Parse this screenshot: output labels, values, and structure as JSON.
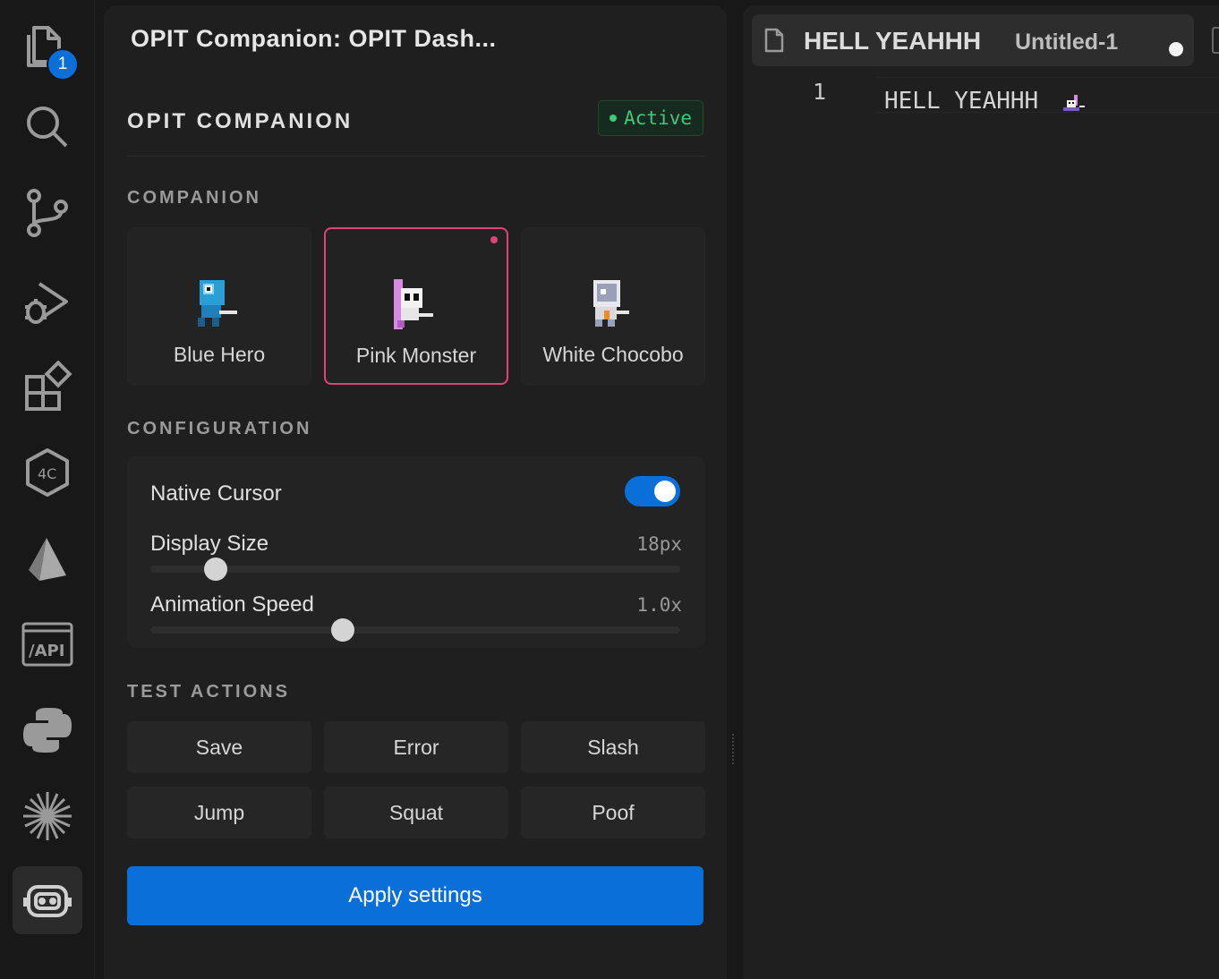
{
  "activity_bar": {
    "items": [
      {
        "icon": "explorer-icon",
        "badge": "1"
      },
      {
        "icon": "search-icon"
      },
      {
        "icon": "source-control-icon"
      },
      {
        "icon": "run-debug-icon"
      },
      {
        "icon": "extensions-icon"
      },
      {
        "icon": "remote-hex-icon"
      },
      {
        "icon": "prism-icon"
      },
      {
        "icon": "api-icon"
      },
      {
        "icon": "python-icon"
      },
      {
        "icon": "sparkle-icon"
      },
      {
        "icon": "companion-robot-icon",
        "active": true
      }
    ]
  },
  "sidebar": {
    "title": "OPIT Companion: OPIT Dash...",
    "panel_title": "OPIT COMPANION",
    "status": "Active",
    "status_color": "#3ec97a",
    "sections": {
      "companion": "COMPANION",
      "configuration": "CONFIGURATION",
      "test_actions": "TEST ACTIONS"
    },
    "companions": [
      {
        "name": "Blue Hero",
        "selected": false
      },
      {
        "name": "Pink Monster",
        "selected": true
      },
      {
        "name": "White Chocobo",
        "selected": false
      }
    ],
    "config": {
      "native_cursor_label": "Native Cursor",
      "native_cursor_on": true,
      "display_size_label": "Display Size",
      "display_size_value": "18px",
      "display_size_level": 0.1,
      "animation_speed_label": "Animation Speed",
      "animation_speed_value": "1.0x",
      "animation_speed_level": 0.34
    },
    "actions": [
      "Save",
      "Error",
      "Slash",
      "Jump",
      "Squat",
      "Poof"
    ],
    "apply_label": "Apply settings",
    "accent_color": "#0a6fd9",
    "selected_color": "#e0427a"
  },
  "editor": {
    "tab_label": "HELL YEAHHH",
    "tab_description": "Untitled-1",
    "line_number": "1",
    "code": "HELL YEAHHH"
  }
}
